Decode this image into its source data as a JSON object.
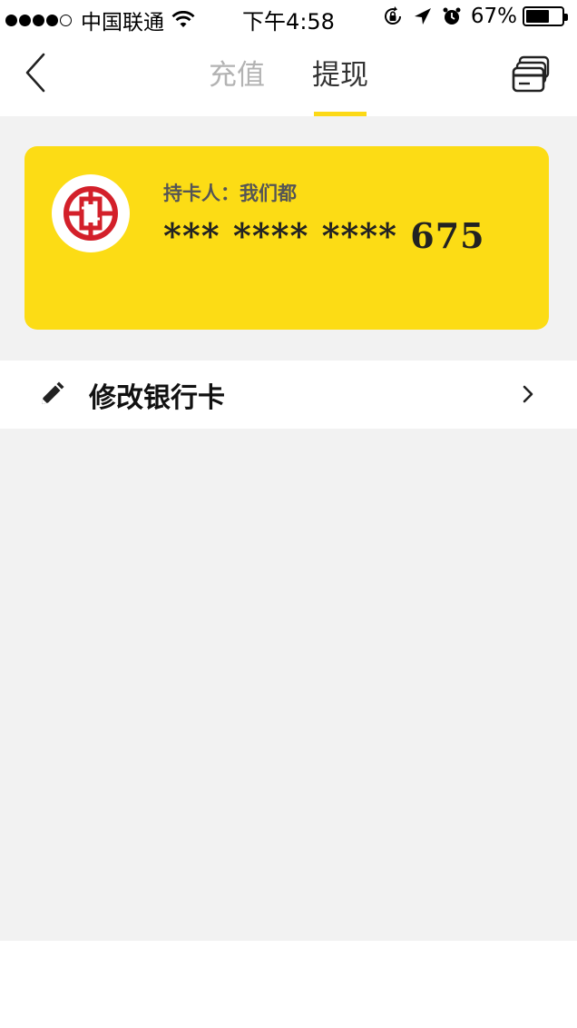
{
  "status_bar": {
    "carrier": "中国联通",
    "time": "下午4:58",
    "battery_percent": "67%",
    "battery_level": 0.67,
    "signal_bars_filled": 4,
    "signal_bars_total": 5
  },
  "nav": {
    "tabs": [
      {
        "label": "充值",
        "active": false
      },
      {
        "label": "提现",
        "active": true
      }
    ]
  },
  "bank_card": {
    "holder_label": "持卡人：",
    "holder_name": "我们都",
    "masked_number": "*** **** ****",
    "last_digits": "675",
    "bank_logo": "icbc-logo-icon",
    "card_color": "#fcdc15"
  },
  "menu": {
    "edit_card_label": "修改银行卡"
  },
  "colors": {
    "accent": "#fcd916",
    "background": "#f2f2f2"
  }
}
